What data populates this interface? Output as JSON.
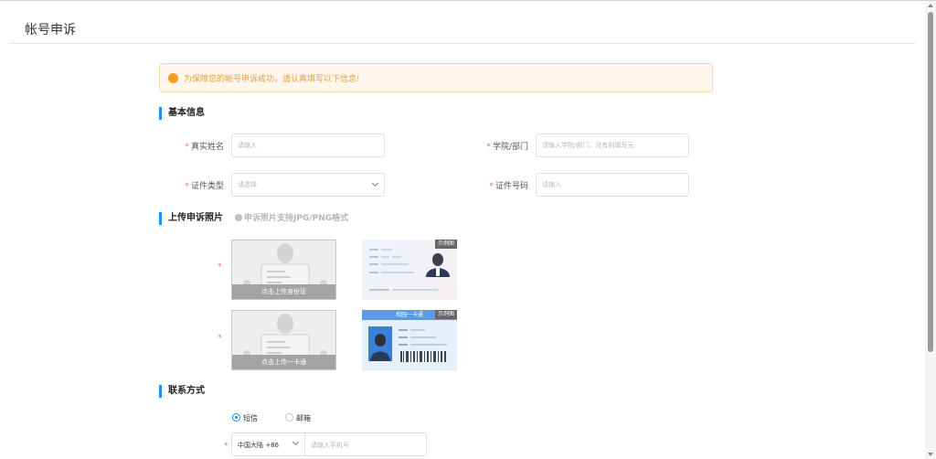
{
  "header": {
    "title": "帐号申诉"
  },
  "alert": {
    "text": "为保障您的帐号申诉成功，请认真填写以下信息!"
  },
  "basic_info": {
    "section_title": "基本信息",
    "real_name": {
      "label": "真实姓名",
      "placeholder": "请输入"
    },
    "department": {
      "label": "学院/部门",
      "placeholder": "请输入学院/部门，没有则填写无"
    },
    "id_type": {
      "label": "证件类型",
      "placeholder": "请选择"
    },
    "id_number": {
      "label": "证件号码",
      "placeholder": "请输入"
    }
  },
  "upload": {
    "section_title": "上传申诉照片",
    "hint": "申诉照片支持JPG/PNG格式",
    "id_card_caption": "点击上传身份证",
    "campus_card_caption": "点击上传一卡通",
    "sample_tag": "示例图",
    "campus_sample_title": "校园一卡通"
  },
  "contact": {
    "section_title": "联系方式",
    "options": [
      "短信",
      "邮箱"
    ],
    "selected": "短信",
    "country_code": "中国大陆 +86",
    "phone_placeholder": "请输入手机号"
  },
  "colors": {
    "accent": "#1890ff",
    "warning": "#e6a23c",
    "required": "#f56c6c"
  }
}
